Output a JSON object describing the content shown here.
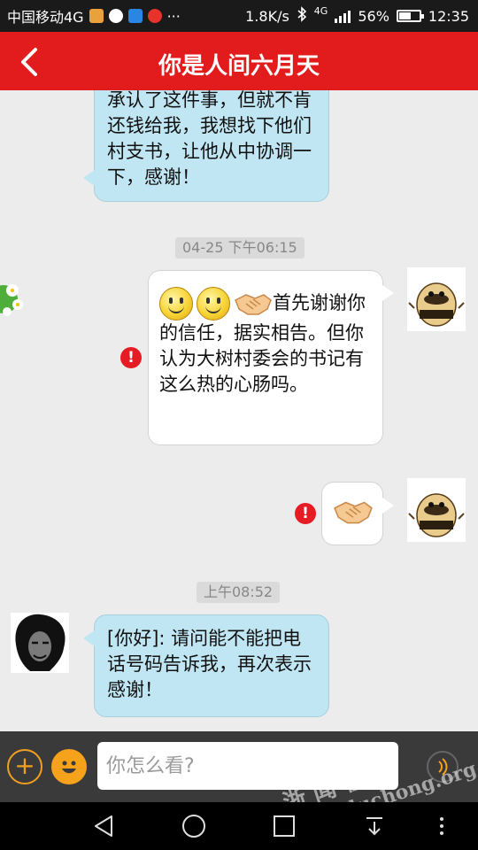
{
  "status_bar": {
    "carrier": "中国移动4G",
    "dots": "···",
    "speed": "1.8K/s",
    "network_type": "4G",
    "battery": "56%",
    "time": "12:35"
  },
  "header": {
    "title": "你是人间六月天"
  },
  "messages": [
    {
      "side": "left",
      "text": "承认了这件事，但就不肯还钱给我，我想找下他们村支书，让他从中协调一下，感谢！"
    },
    {
      "type": "timestamp",
      "text": "04-25 下午06:15"
    },
    {
      "side": "right",
      "emoji": [
        "smiley",
        "smiley",
        "handshake"
      ],
      "text": "首先谢谢你的信任，据实相告。但你认为大树村委会的书记有这么热的心肠吗。",
      "failed": true
    },
    {
      "side": "right",
      "emoji": [
        "handshake"
      ],
      "failed": true
    },
    {
      "type": "timestamp",
      "text": "上午08:52"
    },
    {
      "side": "left",
      "text": "[你好]: 请问能不能把电话号码告诉我，再次表示感谢！"
    }
  ],
  "input": {
    "placeholder": "你怎么看?"
  },
  "watermark": {
    "line1": "浙 闻 在 线",
    "line2": "www.duchong.org"
  },
  "colors": {
    "header_bg": "#e21c1c",
    "left_bubble": "#bfe6f2",
    "right_bubble": "#ffffff",
    "error": "#e51c23",
    "accent": "#f7a21b"
  },
  "icons": {
    "back": "chevron-left-icon",
    "error": "exclamation-icon",
    "plus": "plus-icon",
    "emoji": "smiley-icon",
    "voice": "microphone-icon",
    "nav_back": "triangle-back-icon",
    "nav_home": "circle-home-icon",
    "nav_recent": "square-recent-icon",
    "nav_down": "download-icon",
    "nav_menu": "vertical-dots-icon"
  }
}
